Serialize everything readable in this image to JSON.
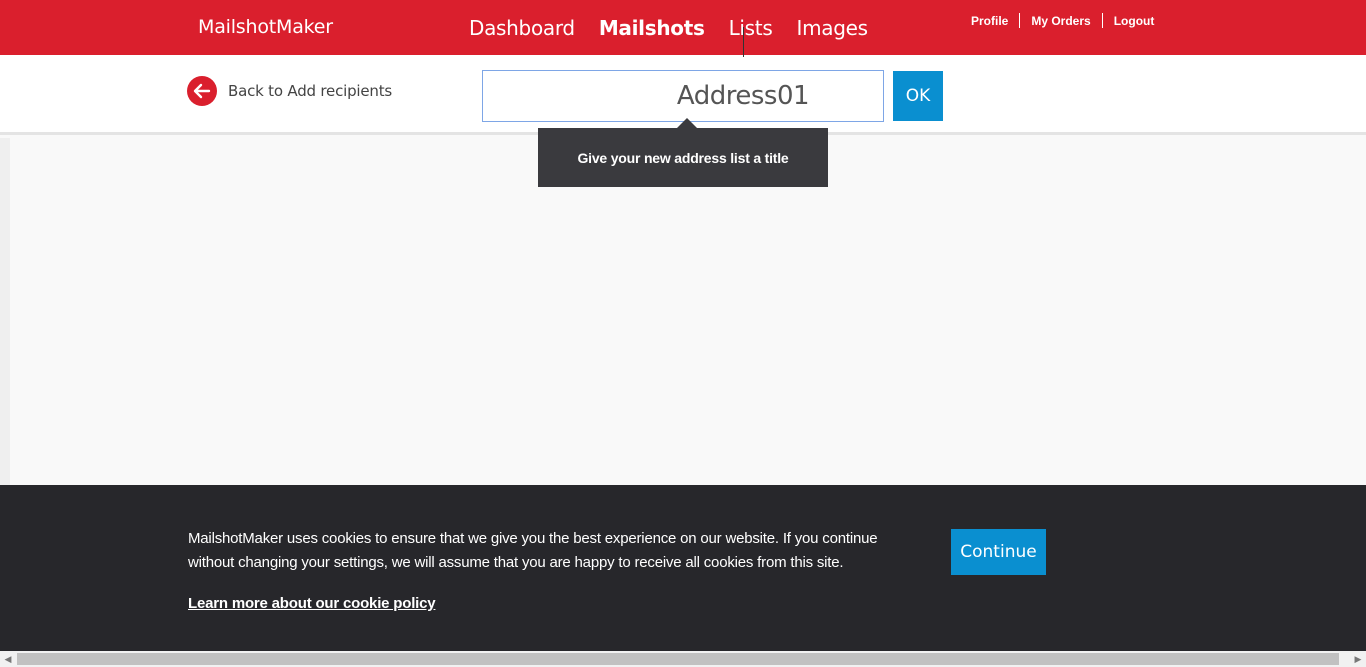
{
  "header": {
    "logo": "MailshotMaker",
    "nav": [
      "Dashboard",
      "Mailshots",
      "Lists",
      "Images"
    ],
    "user_nav": [
      "Profile",
      "My Orders",
      "Logout"
    ]
  },
  "subheader": {
    "back_label": "Back to Add recipients",
    "title_value": "Address01",
    "ok_label": "OK"
  },
  "tooltip": {
    "text": "Give your new address list a title"
  },
  "cookie": {
    "text": "MailshotMaker uses cookies to ensure that we give you the best experience on our website. If you continue without changing your settings, we will assume that you are happy to receive all cookies from this site.",
    "link": "Learn more about our cookie policy",
    "button": "Continue"
  },
  "colors": {
    "brand_red": "#da1f2d",
    "accent_blue": "#0a8fd0",
    "banner_dark": "#27272b"
  },
  "icons": {
    "back": "arrow-left-circle-icon"
  }
}
